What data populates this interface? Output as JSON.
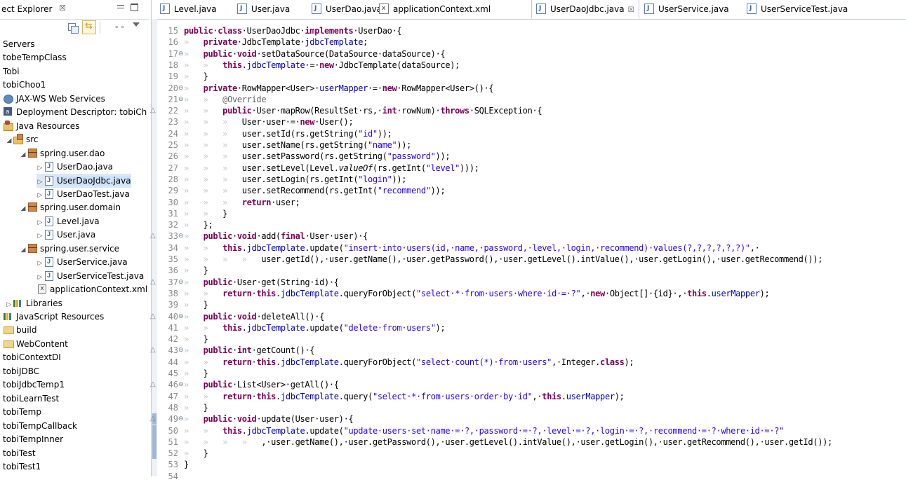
{
  "explorer": {
    "title": "ect Explorer",
    "close_glyph": "☒",
    "items": [
      {
        "label": "Servers",
        "indent": 0,
        "icon": "none",
        "arrow": ""
      },
      {
        "label": "tobeTempClass",
        "indent": 0,
        "icon": "none",
        "arrow": ""
      },
      {
        "label": "Tobi",
        "indent": 0,
        "icon": "none",
        "arrow": ""
      },
      {
        "label": "tobiChoo1",
        "indent": 0,
        "icon": "none",
        "arrow": ""
      },
      {
        "label": "JAX-WS Web Services",
        "indent": 0,
        "icon": "web",
        "arrow": ""
      },
      {
        "label": "Deployment Descriptor: tobiCh",
        "indent": 0,
        "icon": "dd",
        "arrow": ""
      },
      {
        "label": "Java Resources",
        "indent": 0,
        "icon": "jr",
        "arrow": ""
      },
      {
        "label": "src",
        "indent": 1,
        "icon": "src",
        "arrow": "◢"
      },
      {
        "label": "spring.user.dao",
        "indent": 2,
        "icon": "pkg",
        "arrow": "◢"
      },
      {
        "label": "UserDao.java",
        "indent": 3,
        "icon": "java",
        "arrow": "▷"
      },
      {
        "label": "UserDaoJdbc.java",
        "indent": 3,
        "icon": "java",
        "arrow": "▷",
        "selected": true
      },
      {
        "label": "UserDaoTest.java",
        "indent": 3,
        "icon": "java",
        "arrow": "▷"
      },
      {
        "label": "spring.user.domain",
        "indent": 2,
        "icon": "pkg",
        "arrow": "◢"
      },
      {
        "label": "Level.java",
        "indent": 3,
        "icon": "java",
        "arrow": "▷"
      },
      {
        "label": "User.java",
        "indent": 3,
        "icon": "java",
        "arrow": "▷"
      },
      {
        "label": "spring.user.service",
        "indent": 2,
        "icon": "pkg",
        "arrow": "◢"
      },
      {
        "label": "UserService.java",
        "indent": 3,
        "icon": "java",
        "arrow": "▷"
      },
      {
        "label": "UserServiceTest.java",
        "indent": 3,
        "icon": "java",
        "arrow": "▷"
      },
      {
        "label": "applicationContext.xml",
        "indent": 3,
        "icon": "xml",
        "arrow": ""
      },
      {
        "label": "Libraries",
        "indent": 1,
        "icon": "lib",
        "arrow": "▷"
      },
      {
        "label": "JavaScript Resources",
        "indent": 0,
        "icon": "jsr",
        "arrow": ""
      },
      {
        "label": "build",
        "indent": 0,
        "icon": "folder",
        "arrow": ""
      },
      {
        "label": "WebContent",
        "indent": 0,
        "icon": "folder",
        "arrow": ""
      },
      {
        "label": "tobiContextDI",
        "indent": 0,
        "icon": "none",
        "arrow": ""
      },
      {
        "label": "tobiJDBC",
        "indent": 0,
        "icon": "none",
        "arrow": ""
      },
      {
        "label": "tobiJdbcTemp1",
        "indent": 0,
        "icon": "none",
        "arrow": ""
      },
      {
        "label": "tobiLearnTest",
        "indent": 0,
        "icon": "none",
        "arrow": ""
      },
      {
        "label": "tobiTemp",
        "indent": 0,
        "icon": "none",
        "arrow": ""
      },
      {
        "label": "tobiTempCallback",
        "indent": 0,
        "icon": "none",
        "arrow": ""
      },
      {
        "label": "tobiTempInner",
        "indent": 0,
        "icon": "none",
        "arrow": ""
      },
      {
        "label": "tobiTest",
        "indent": 0,
        "icon": "none",
        "arrow": ""
      },
      {
        "label": "tobiTest1",
        "indent": 0,
        "icon": "none",
        "arrow": ""
      }
    ]
  },
  "tabs": [
    {
      "label": "Level.java",
      "icon": "java"
    },
    {
      "label": "User.java",
      "icon": "java"
    },
    {
      "label": "UserDao.java",
      "icon": "java"
    },
    {
      "label": "applicationContext.xml",
      "icon": "xml"
    },
    {
      "label": "UserDaoJdbc.java",
      "icon": "java",
      "active": true,
      "close": "☒"
    },
    {
      "label": "UserService.java",
      "icon": "java"
    },
    {
      "label": "UserServiceTest.java",
      "icon": "java"
    }
  ],
  "code": {
    "lines": [
      {
        "n": "15",
        "marker": "",
        "html": "<span class='kw'>public</span>·<span class='kw'>class</span>·UserDaoJdbc·<span class='kw'>implements</span>·UserDao·{"
      },
      {
        "n": "16",
        "marker": "",
        "html": "<span class='ws'>»   </span><span class='kw'>private</span>·JdbcTemplate·<span class='fld'>jdbcTemplate</span>;"
      },
      {
        "n": "17",
        "marker": "fold",
        "html": "<span class='ws'>»   </span><span class='kw'>public</span>·<span class='kw'>void</span>·setDataSource(DataSource·dataSource)·{"
      },
      {
        "n": "18",
        "marker": "",
        "html": "<span class='ws'>»   »   </span><span class='kw'>this</span>.<span class='fld'>jdbcTemplate</span>·=·<span class='kw'>new</span>·JdbcTemplate(dataSource);"
      },
      {
        "n": "19",
        "marker": "",
        "html": "<span class='ws'>»   </span>}"
      },
      {
        "n": "20",
        "marker": "fold",
        "html": "<span class='ws'>»   </span><span class='kw'>private</span>·RowMapper&lt;User&gt;·<span class='fld'>userMapper</span>·=·<span class='kw'>new</span>·RowMapper&lt;User&gt;()·{"
      },
      {
        "n": "21",
        "marker": "fold",
        "html": "<span class='ws'>»   »   </span><span class='ann'>@Override</span>"
      },
      {
        "n": "22",
        "marker": "ov",
        "html": "<span class='ws'>»   »   </span><span class='kw'>public</span>·User·mapRow(ResultSet·rs,·<span class='kw'>int</span>·rowNum)·<span class='kw'>throws</span>·SQLException·{"
      },
      {
        "n": "23",
        "marker": "",
        "html": "<span class='ws'>»   »   »   </span>User·user·=·<span class='kw'>new</span>·User();"
      },
      {
        "n": "24",
        "marker": "",
        "html": "<span class='ws'>»   »   »   </span>user.setId(rs.getString(<span class='str'>\"id\"</span>));"
      },
      {
        "n": "25",
        "marker": "",
        "html": "<span class='ws'>»   »   »   </span>user.setName(rs.getString(<span class='str'>\"name\"</span>));"
      },
      {
        "n": "26",
        "marker": "",
        "html": "<span class='ws'>»   »   »   </span>user.setPassword(rs.getString(<span class='str'>\"password\"</span>));"
      },
      {
        "n": "27",
        "marker": "",
        "html": "<span class='ws'>»   »   »   </span>user.setLevel(Level.<span class='it'>valueOf</span>(rs.getInt(<span class='str'>\"level\"</span>)));"
      },
      {
        "n": "28",
        "marker": "",
        "html": "<span class='ws'>»   »   »   </span>user.setLogin(rs.getInt(<span class='str'>\"login\"</span>));"
      },
      {
        "n": "29",
        "marker": "",
        "html": "<span class='ws'>»   »   »   </span>user.setRecommend(rs.getInt(<span class='str'>\"recommend\"</span>));"
      },
      {
        "n": "30",
        "marker": "",
        "html": "<span class='ws'>»   »   »   </span><span class='kw'>return</span>·user;"
      },
      {
        "n": "31",
        "marker": "",
        "html": "<span class='ws'>»   »   </span>}"
      },
      {
        "n": "32",
        "marker": "",
        "html": "<span class='ws'>»   </span>};"
      },
      {
        "n": "33",
        "marker": "ovfold",
        "html": "<span class='ws'>»   </span><span class='kw'>public</span>·<span class='kw'>void</span>·add(<span class='kw'>final</span>·User·user)·{"
      },
      {
        "n": "34",
        "marker": "",
        "html": "<span class='ws'>»   »   </span><span class='kw'>this</span>.<span class='fld'>jdbcTemplate</span>.update(<span class='str'>\"insert·into·users(id,·name,·password,·level,·login,·recommend)·values(?,?,?,?,?,?)\"</span>,·"
      },
      {
        "n": "35",
        "marker": "",
        "html": "<span class='ws'>»   »   »   »   </span>user.getId(),·user.getName(),·user.getPassword(),·user.getLevel().intValue(),·user.getLogin(),·user.getRecommend());"
      },
      {
        "n": "36",
        "marker": "",
        "html": "<span class='ws'>»   </span>}"
      },
      {
        "n": "37",
        "marker": "ovfold",
        "html": "<span class='ws'>»   </span><span class='kw'>public</span>·User·get(String·id)·{"
      },
      {
        "n": "38",
        "marker": "",
        "html": "<span class='ws'>»   »   </span><span class='kw'>return</span>·<span class='kw'>this</span>.<span class='fld'>jdbcTemplate</span>.queryForObject(<span class='str'>\"select·*·from·users·where·id·=·?\"</span>,·<span class='kw'>new</span>·Object[]·{id}·,·<span class='kw'>this</span>.<span class='fld'>userMapper</span>);"
      },
      {
        "n": "39",
        "marker": "",
        "html": "<span class='ws'>»   </span>}"
      },
      {
        "n": "40",
        "marker": "ovfold",
        "html": "<span class='ws'>»   </span><span class='kw'>public</span>·<span class='kw'>void</span>·deleteAll()·{"
      },
      {
        "n": "41",
        "marker": "",
        "html": "<span class='ws'>»   »   </span><span class='kw'>this</span>.<span class='fld'>jdbcTemplate</span>.update(<span class='str'>\"delete·from·users\"</span>);"
      },
      {
        "n": "42",
        "marker": "",
        "html": "<span class='ws'>»   </span>}"
      },
      {
        "n": "43",
        "marker": "ovfold",
        "html": "<span class='ws'>»   </span><span class='kw'>public</span>·<span class='kw'>int</span>·getCount()·{"
      },
      {
        "n": "44",
        "marker": "",
        "html": "<span class='ws'>»   »   </span><span class='kw'>return</span>·<span class='kw'>this</span>.<span class='fld'>jdbcTemplate</span>.queryForObject(<span class='str'>\"select·count(*)·from·users\"</span>,·Integer.<span class='kw'>class</span>);"
      },
      {
        "n": "45",
        "marker": "",
        "html": "<span class='ws'>»   </span>}"
      },
      {
        "n": "46",
        "marker": "ovfold",
        "html": "<span class='ws'>»   </span><span class='kw'>public</span>·List&lt;User&gt;·getAll()·{"
      },
      {
        "n": "47",
        "marker": "",
        "html": "<span class='ws'>»   »   </span><span class='kw'>return</span>·<span class='kw'>this</span>.<span class='fld'>jdbcTemplate</span>.query(<span class='str'>\"select·*·from·users·order·by·id\"</span>,·<span class='kw'>this</span>.<span class='fld'>userMapper</span>);"
      },
      {
        "n": "48",
        "marker": "",
        "html": "<span class='ws'>»   </span>}"
      },
      {
        "n": "49",
        "marker": "ovfoldbar",
        "html": "<span class='ws'>»   </span><span class='kw'>public</span>·<span class='kw'>void</span>·update(User·user)·{"
      },
      {
        "n": "50",
        "marker": "bar",
        "html": "<span class='ws'>»   »   </span><span class='kw'>this</span>.<span class='fld'>jdbcTemplate</span>.update(<span class='str'>\"update·users·set·name·=·?,·password·=·?,·level·=·?,·login·=·?,·recommend·=·?·where·id·=·?\"</span>"
      },
      {
        "n": "51",
        "marker": "bar",
        "html": "<span class='ws'>»   »   »   »   </span>,·user.getName(),·user.getPassword(),·user.getLevel().intValue(),·user.getLogin(),·user.getRecommend(),·user.getId());"
      },
      {
        "n": "52",
        "marker": "bar",
        "html": "<span class='ws'>»   </span>}"
      },
      {
        "n": "53",
        "marker": "",
        "html": "}"
      },
      {
        "n": "54",
        "marker": "",
        "html": ""
      }
    ]
  }
}
